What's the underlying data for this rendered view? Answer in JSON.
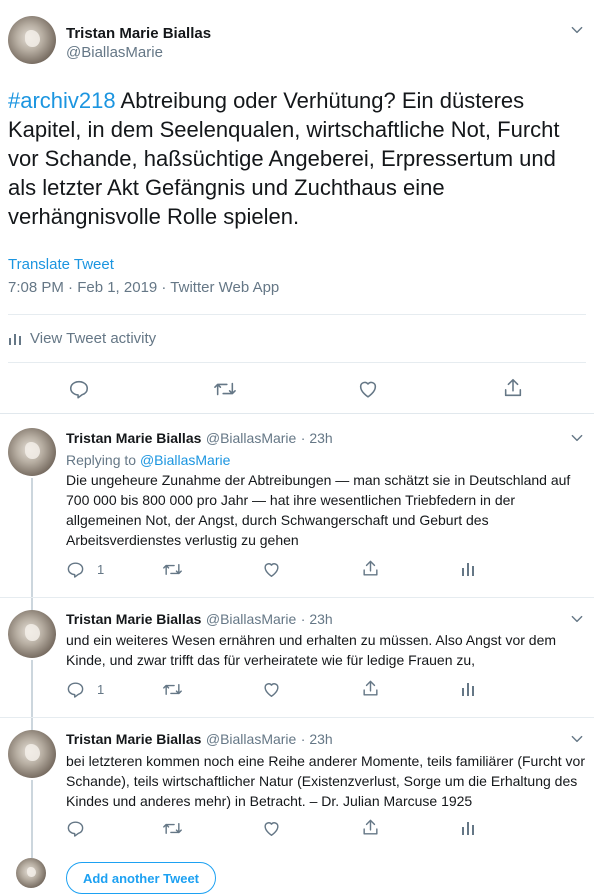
{
  "main_tweet": {
    "author_name": "Tristan Marie Biallas",
    "author_handle": "@BiallasMarie",
    "hashtag": "#archiv218",
    "text": " Abtreibung oder Verhütung? Ein düsteres Kapitel, in dem Seelenqualen, wirtschaftliche Not, Furcht vor Schande, haßsüchtige Angeberei, Erpressertum und als letzter Akt Gefängnis und Zuchthaus eine verhängnisvolle Rolle spielen.",
    "translate_label": "Translate Tweet",
    "timestamp": "7:08 PM · Feb 1, 2019 · Twitter Web App",
    "activity_label": "View Tweet activity"
  },
  "replies": [
    {
      "author_name": "Tristan Marie Biallas",
      "author_handle": "@BiallasMarie",
      "time": "· 23h",
      "replying_to_prefix": "Replying to ",
      "replying_to_handle": "@BiallasMarie",
      "text": "Die ungeheure Zunahme der Abtreibungen — man schätzt sie in Deutschland auf 700 000 bis 800 000 pro Jahr — hat ihre wesentlichen Triebfedern in der allgemeinen Not, der Angst, durch Schwangerschaft und Geburt des Arbeitsverdienstes verlustig zu gehen",
      "reply_count": "1"
    },
    {
      "author_name": "Tristan Marie Biallas",
      "author_handle": "@BiallasMarie",
      "time": "· 23h",
      "text": "und ein weiteres Wesen ernähren und erhalten zu müssen. Also Angst vor dem Kinde, und zwar trifft das für verheiratete wie für ledige Frauen zu,",
      "reply_count": "1"
    },
    {
      "author_name": "Tristan Marie Biallas",
      "author_handle": "@BiallasMarie",
      "time": "· 23h",
      "text": "bei letzteren kommen noch eine Reihe anderer Momente, teils familiärer (Furcht vor Schande), teils wirtschaftlicher Natur (Existenzverlust, Sorge um die Erhaltung des Kindes und anderes mehr) in Betracht. – Dr. Julian Marcuse 1925",
      "reply_count": ""
    }
  ],
  "add_tweet_label": "Add another Tweet",
  "colors": {
    "link": "#1b95e0",
    "muted": "#657786",
    "accent": "#1da1f2",
    "divider": "#e6ecf0"
  },
  "icons": [
    "chevron-down-icon",
    "activity-icon",
    "reply-icon",
    "retweet-icon",
    "like-icon",
    "share-icon",
    "analytics-icon"
  ]
}
